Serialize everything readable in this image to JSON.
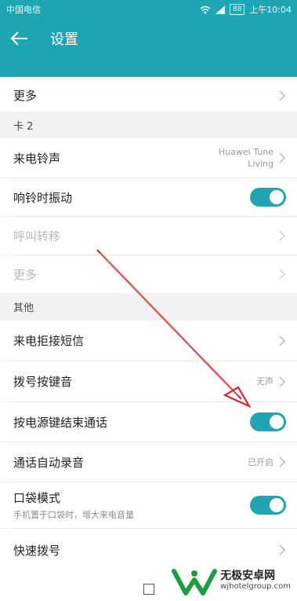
{
  "status": {
    "carrier": "中国电信",
    "battery": "88",
    "time": "上午10:04"
  },
  "appbar": {
    "title": "设置"
  },
  "rows": {
    "more1": {
      "label": "更多"
    },
    "ringtone": {
      "label": "来电铃声",
      "value_line1": "Huawei Tune",
      "value_line2": "Living"
    },
    "vibrate": {
      "label": "响铃时振动",
      "on": true
    },
    "forward": {
      "label": "呼叫转移"
    },
    "more2": {
      "label": "更多"
    },
    "reject_sms": {
      "label": "来电拒接短信"
    },
    "dial_tone": {
      "label": "拨号按键音",
      "value": "无声"
    },
    "power_end": {
      "label": "按电源键结束通话",
      "on": true
    },
    "auto_record": {
      "label": "通话自动录音",
      "value": "已开启"
    },
    "pocket": {
      "label": "口袋模式",
      "sub": "手机置于口袋时，增大来电音量",
      "on": true
    },
    "speed_dial": {
      "label": "快速拨号"
    }
  },
  "sections": {
    "sim2": "卡 2",
    "other": "其他"
  },
  "watermark": {
    "name": "无极安卓网",
    "url": "wjhotelgroup.com"
  },
  "colors": {
    "accent": "#1fa6b3",
    "toggle_on": "#21a5b3",
    "arrow": "#d9262a"
  }
}
